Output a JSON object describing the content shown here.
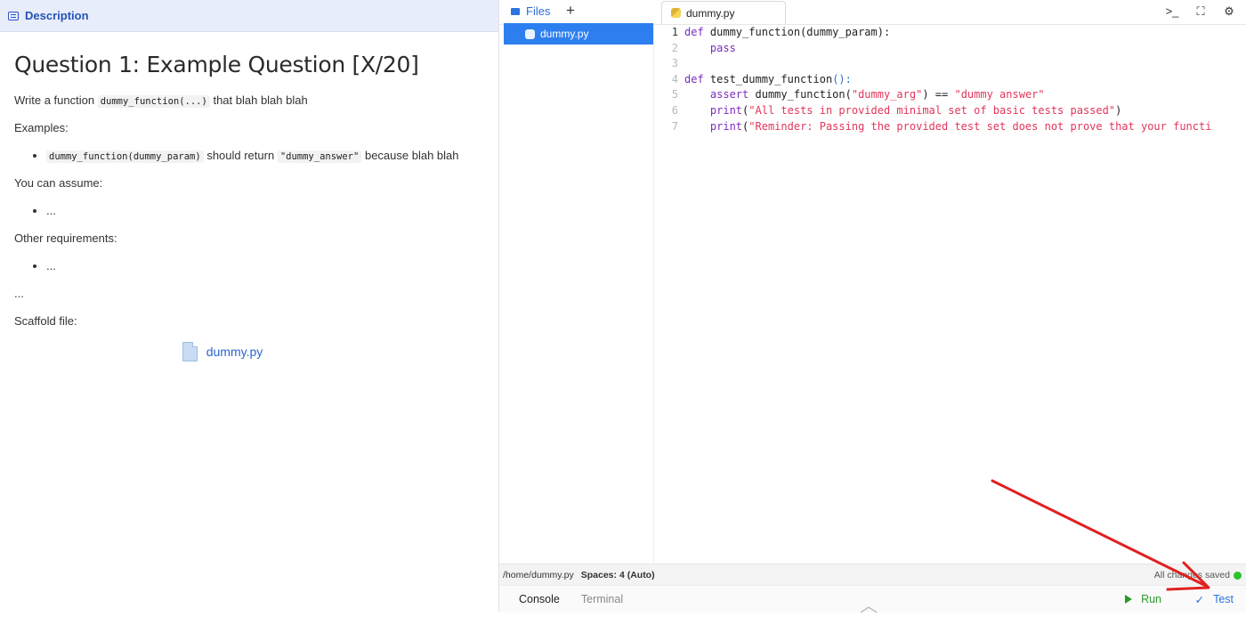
{
  "description_panel": {
    "header_label": "Description",
    "heading": "Question 1: Example Question [X/20]",
    "intro_prefix": "Write a function",
    "intro_code": "dummy_function(...)",
    "intro_suffix": "that blah blah blah",
    "examples_label": "Examples:",
    "example_code1": "dummy_function(dummy_param)",
    "example_mid": "should return",
    "example_code2": "\"dummy_answer\"",
    "example_suffix": "because blah blah",
    "assume_label": "You can assume:",
    "assume_item": "...",
    "other_label": "Other requirements:",
    "other_item": "...",
    "ellipsis": "...",
    "scaffold_label": "Scaffold file:",
    "scaffold_file": "dummy.py"
  },
  "ide": {
    "files_tab_label": "Files",
    "new_file_symbol": "+",
    "editor_tab_label": "dummy.py",
    "toolbar_icons": [
      "terminal-icon",
      "fullscreen-icon",
      "settings-icon"
    ],
    "file_tree": [
      "dummy.py"
    ],
    "code_lines": [
      {
        "n": "1"
      },
      {
        "n": "2"
      },
      {
        "n": "3"
      },
      {
        "n": "4"
      },
      {
        "n": "5"
      },
      {
        "n": "6"
      },
      {
        "n": "7"
      }
    ],
    "code": {
      "l1_kw": "def",
      "l1_rest": " dummy_function(dummy_param):",
      "l2_kw": "pass",
      "l4_kw": "def",
      "l4_rest": " test_dummy_function",
      "l4_paren": "():",
      "l5_kw": "assert",
      "l5_fn": " dummy_function(",
      "l5_str1": "\"dummy_arg\"",
      "l5_mid": ") == ",
      "l5_str2": "\"dummy answer\"",
      "l6_kw": "print",
      "l6_p": "(",
      "l6_str": "\"All tests in provided minimal set of basic tests passed\"",
      "l6_end": ")",
      "l7_kw": "print",
      "l7_p": "(",
      "l7_str": "\"Reminder: Passing the provided test set does not prove that your functi"
    },
    "status": {
      "path": "/home/dummy.py",
      "spaces": "Spaces: 4 (Auto)",
      "saved": "All changes saved"
    },
    "bottom": {
      "console": "Console",
      "terminal": "Terminal",
      "run": "Run",
      "test": "Test"
    },
    "colors": {
      "accent": "#2d7ff0",
      "keyword": "#7b2bbf",
      "string": "#e2365a",
      "saved_dot": "#2ec22e",
      "annotation_arrow": "#e02020"
    }
  }
}
